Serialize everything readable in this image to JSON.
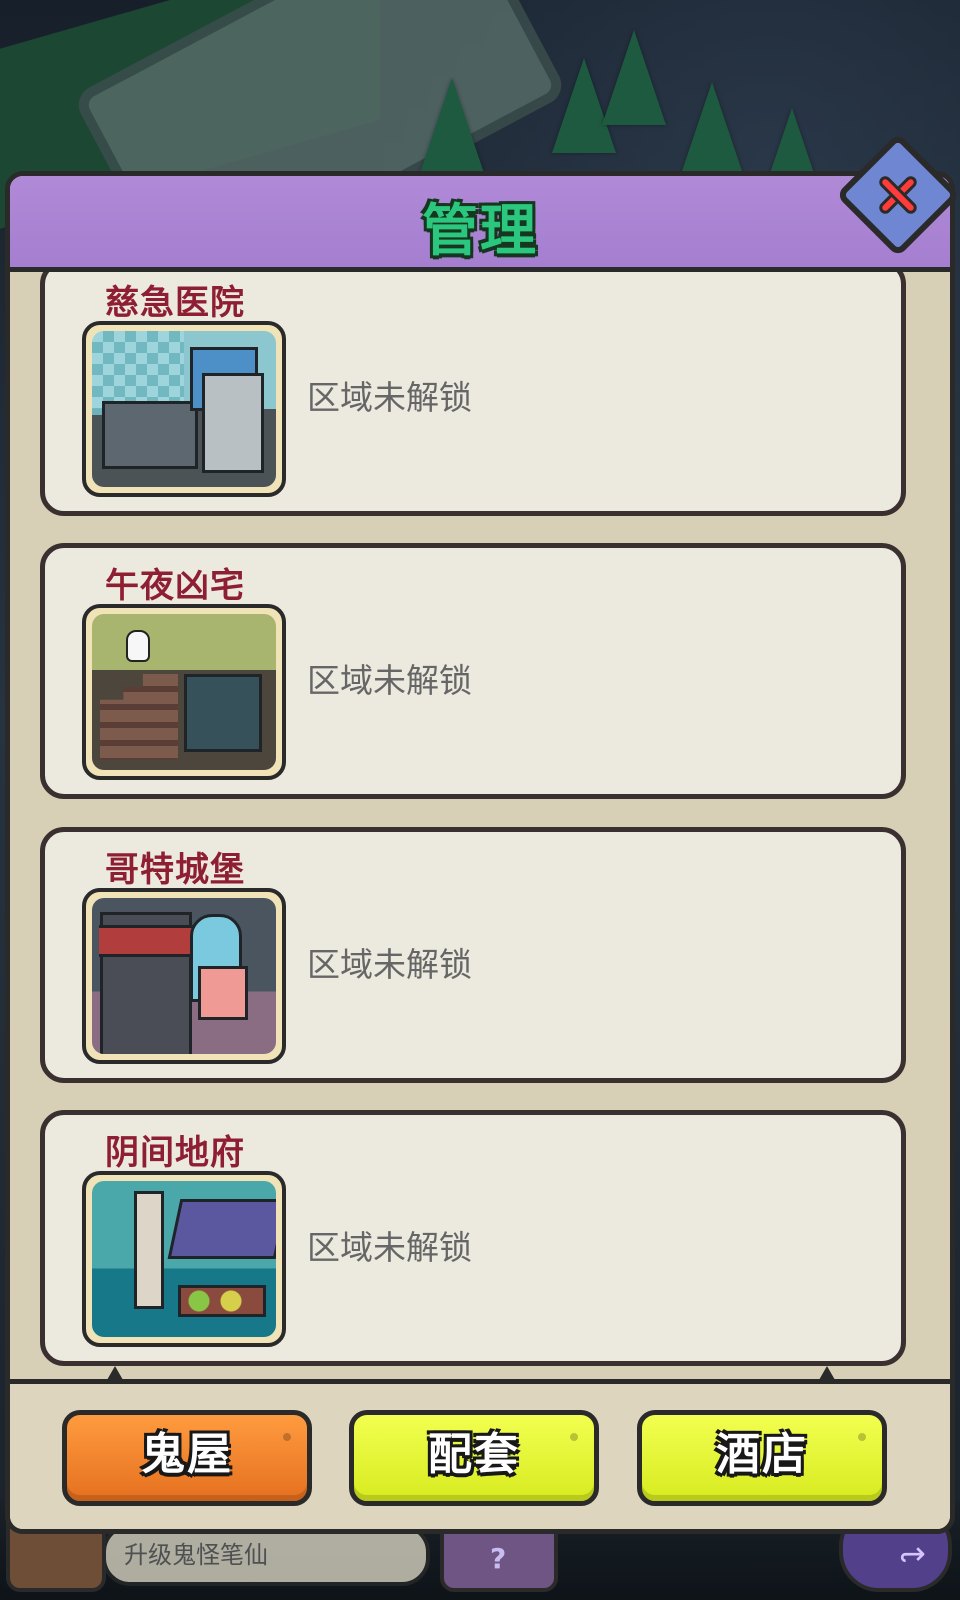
{
  "header": {
    "title": "管理"
  },
  "cards": [
    {
      "name": "慈急医院",
      "status": "区域未解锁"
    },
    {
      "name": "午夜凶宅",
      "status": "区域未解锁"
    },
    {
      "name": "哥特城堡",
      "status": "区域未解锁"
    },
    {
      "name": "阴间地府",
      "status": "区域未解锁"
    }
  ],
  "footer": {
    "tabs": [
      {
        "label": "鬼屋"
      },
      {
        "label": "配套"
      },
      {
        "label": "酒店"
      }
    ]
  },
  "background": {
    "bottom_pill_text": "升级鬼怪笔仙"
  },
  "icons": {
    "close": "close-icon",
    "question": "question-mark-icon",
    "back": "back-arrow-icon"
  },
  "colors": {
    "title_green": "#2bc77f",
    "header_purple": "#a57ed0",
    "card_title": "#8e1f33",
    "active_tab": "#e5701f",
    "inactive_tab": "#d7eb1f"
  }
}
